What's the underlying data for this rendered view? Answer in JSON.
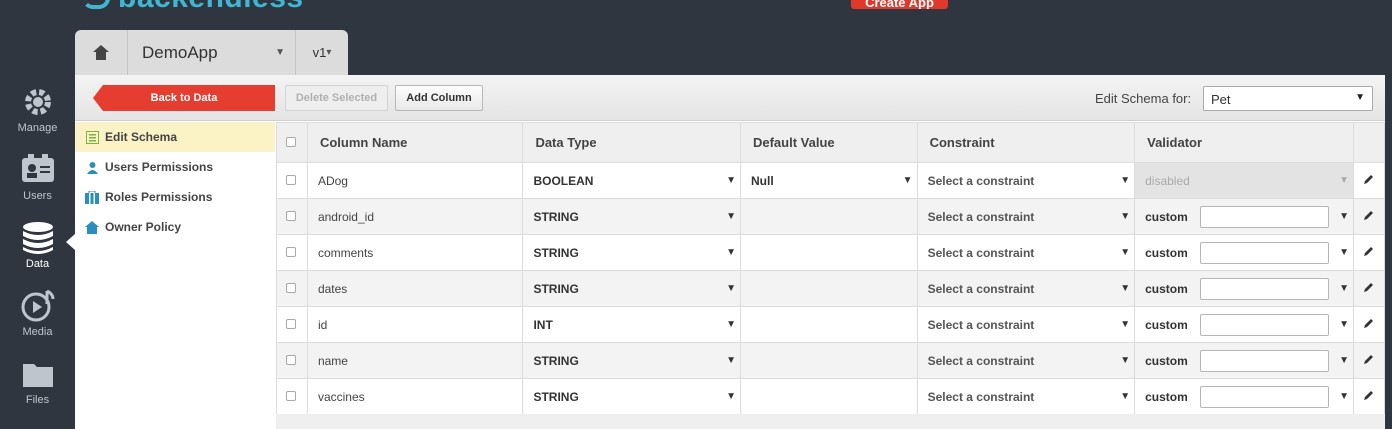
{
  "brand": {
    "logo_text": "backendless"
  },
  "top": {
    "create_app": "Create App",
    "user_text": ""
  },
  "leftnav": [
    {
      "label": "Manage",
      "icon": "gear-icon"
    },
    {
      "label": "Users",
      "icon": "users-icon"
    },
    {
      "label": "Data",
      "icon": "database-icon",
      "active": true
    },
    {
      "label": "Media",
      "icon": "media-icon"
    },
    {
      "label": "Files",
      "icon": "folder-icon"
    }
  ],
  "app": {
    "name": "DemoApp",
    "version": "v1"
  },
  "toolbar": {
    "back_label": "Back to Data",
    "delete_label": "Delete Selected",
    "add_column_label": "Add Column",
    "schema_for_label": "Edit Schema for:",
    "schema_for_value": "Pet"
  },
  "subnav": [
    {
      "label": "Edit Schema",
      "icon": "edit-schema-icon",
      "active": true
    },
    {
      "label": "Users Permissions",
      "icon": "user-icon"
    },
    {
      "label": "Roles Permissions",
      "icon": "roles-icon"
    },
    {
      "label": "Owner Policy",
      "icon": "home-icon"
    }
  ],
  "table": {
    "headers": [
      "Column Name",
      "Data Type",
      "Default Value",
      "Constraint",
      "Validator"
    ],
    "rows": [
      {
        "name": "ADog",
        "type": "BOOLEAN",
        "default": "Null",
        "constraint": "Select a constraint",
        "validator": "disabled"
      },
      {
        "name": "android_id",
        "type": "STRING",
        "default": "",
        "constraint": "Select a constraint",
        "validator": "custom"
      },
      {
        "name": "comments",
        "type": "STRING",
        "default": "",
        "constraint": "Select a constraint",
        "validator": "custom"
      },
      {
        "name": "dates",
        "type": "STRING",
        "default": "",
        "constraint": "Select a constraint",
        "validator": "custom"
      },
      {
        "name": "id",
        "type": "INT",
        "default": "",
        "constraint": "Select a constraint",
        "validator": "custom"
      },
      {
        "name": "name",
        "type": "STRING",
        "default": "",
        "constraint": "Select a constraint",
        "validator": "custom"
      },
      {
        "name": "vaccines",
        "type": "STRING",
        "default": "",
        "constraint": "Select a constraint",
        "validator": "custom"
      }
    ]
  },
  "colors": {
    "accent_red": "#e53d2f",
    "brand_blue": "#3fb7d4",
    "nav_bg": "#2f3640",
    "active_row": "#fbf2c6"
  }
}
